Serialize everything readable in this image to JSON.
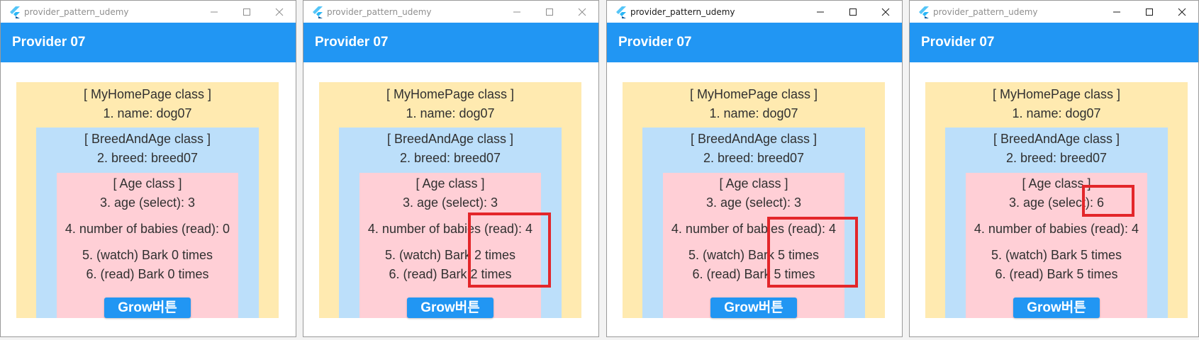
{
  "windows": [
    {
      "title": "provider_pattern_udemy",
      "appbar_title": "Provider 07",
      "home_header": "[ MyHomePage class ]",
      "name_line": "1. name: dog07",
      "breed_header": "[ BreedAndAge class ]",
      "breed_line": "2. breed: breed07",
      "age_header": "[ Age class ]",
      "age_line": "3. age (select): 3",
      "babies_line": "4. number of babies (read): 0",
      "watch_line": "5. (watch) Bark 0 times",
      "read_line": "6. (read) Bark 0 times",
      "grow_button": "Grow버튼"
    },
    {
      "title": "provider_pattern_udemy",
      "appbar_title": "Provider 07",
      "home_header": "[ MyHomePage class ]",
      "name_line": "1. name: dog07",
      "breed_header": "[ BreedAndAge class ]",
      "breed_line": "2. breed: breed07",
      "age_header": "[ Age class ]",
      "age_line": "3. age (select): 3",
      "babies_line": "4. number of babies (read): 4",
      "watch_line": "5. (watch) Bark 2 times",
      "read_line": "6. (read) Bark 2 times",
      "grow_button": "Grow버튼"
    },
    {
      "title": "provider_pattern_udemy",
      "appbar_title": "Provider 07",
      "home_header": "[ MyHomePage class ]",
      "name_line": "1. name: dog07",
      "breed_header": "[ BreedAndAge class ]",
      "breed_line": "2. breed: breed07",
      "age_header": "[ Age class ]",
      "age_line": "3. age (select): 3",
      "babies_line": "4. number of babies (read): 4",
      "watch_line": "5. (watch) Bark 5 times",
      "read_line": "6. (read) Bark 5 times",
      "grow_button": "Grow버튼"
    },
    {
      "title": "provider_pattern_udemy",
      "appbar_title": "Provider 07",
      "home_header": "[ MyHomePage class ]",
      "name_line": "1. name: dog07",
      "breed_header": "[ BreedAndAge class ]",
      "breed_line": "2. breed: breed07",
      "age_header": "[ Age class ]",
      "age_line": "3. age (select): 6",
      "babies_line": "4. number of babies (read): 4",
      "watch_line": "5. (watch) Bark 5 times",
      "read_line": "6. (read) Bark 5 times",
      "grow_button": "Grow버튼"
    }
  ],
  "colors": {
    "appbar": "#2196f3",
    "home_bg": "#ffeab0",
    "breed_bg": "#bcdffa",
    "age_bg": "#ffcfd6",
    "highlight": "#e3262a"
  },
  "icons": {
    "app": "flutter-logo-icon",
    "minimize": "minimize-icon",
    "maximize": "maximize-icon",
    "close": "close-icon"
  }
}
